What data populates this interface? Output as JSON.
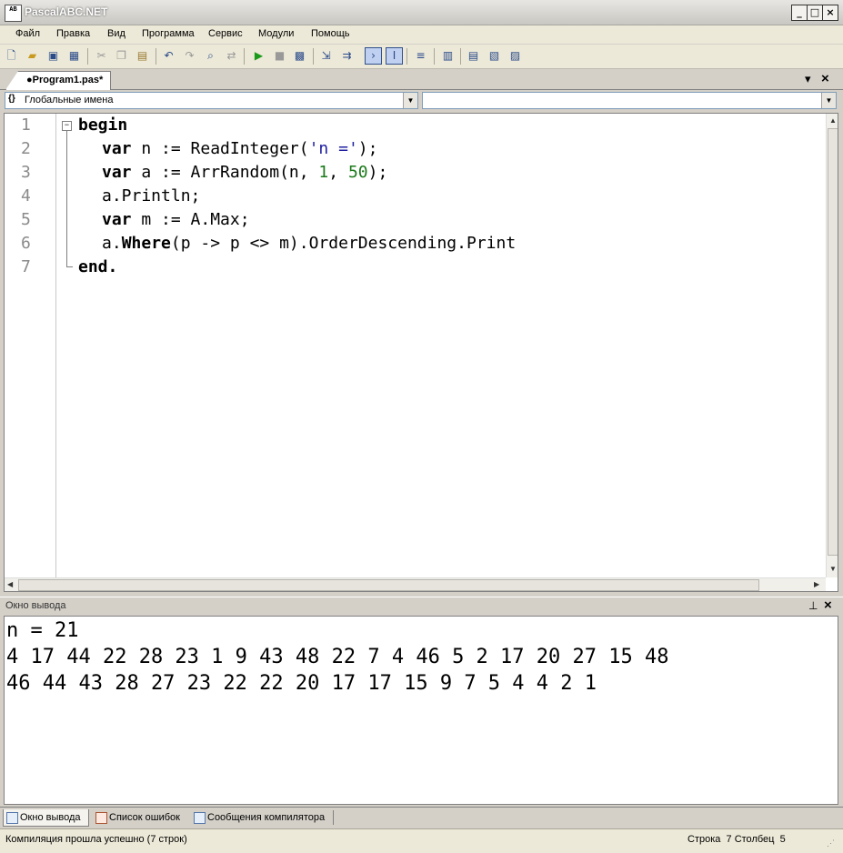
{
  "window": {
    "title": "PascalABC.NET",
    "icon_text": "AB"
  },
  "menu": [
    "Файл",
    "Правка",
    "Вид",
    "Программа",
    "Сервис",
    "Модули",
    "Помощь"
  ],
  "tab": {
    "label": "●Program1.pas*"
  },
  "combo": {
    "left_value": "Глобальные имена",
    "left_icon": "{}"
  },
  "editor": {
    "line_numbers": [
      "1",
      "2",
      "3",
      "4",
      "5",
      "6",
      "7"
    ],
    "lines": {
      "l1_kw": "begin",
      "l2_kw": "var",
      "l2_a": " n := ReadInteger(",
      "l2_str": "'n ='",
      "l2_b": ");",
      "l3_kw": "var",
      "l3_a": " a := ArrRandom(n, ",
      "l3_n1": "1",
      "l3_b": ", ",
      "l3_n2": "50",
      "l3_c": ");",
      "l4": "a.Println;",
      "l5_kw": "var",
      "l5_a": " m := A.Max;",
      "l6_a": "a.",
      "l6_kw": "Where",
      "l6_b": "(p -> p <> m).OrderDescending.Print",
      "l7_kw": "end."
    }
  },
  "output_panel": {
    "title": "Окно вывода",
    "lines": [
      "n = 21",
      "4 17 44 22 28 23 1 9 43 48 22 7 4 46 5 2 17 20 27 15 48",
      "46 44 43 28 27 23 22 22 20 17 17 15 9 7 5 4 4 2 1"
    ]
  },
  "bottom_tabs": [
    "Окно вывода",
    "Список ошибок",
    "Сообщения компилятора"
  ],
  "status": {
    "message": "Компиляция прошла успешно (7 строк)",
    "row_label": "Строка",
    "row_value": "7",
    "col_label": "Столбец",
    "col_value": "5"
  },
  "icons": {
    "minimize": "_",
    "maximize": "□",
    "close": "×",
    "panel_pin": "⊥",
    "panel_close": "×",
    "tab_dropdown": "▾",
    "tab_close": "×"
  }
}
